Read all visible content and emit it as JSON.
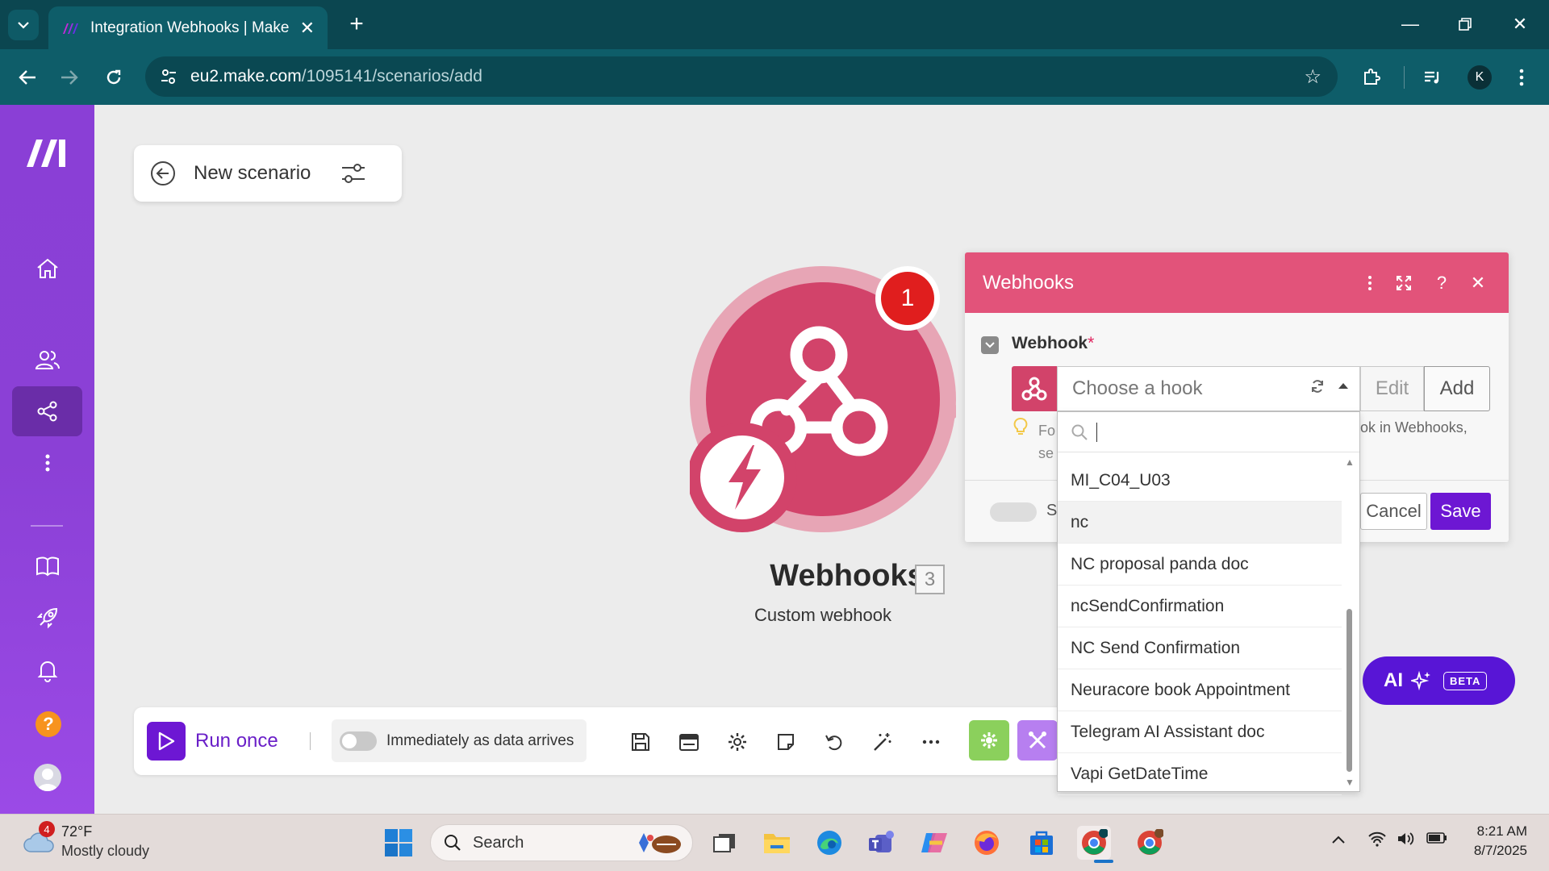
{
  "browser": {
    "tab_title": "Integration Webhooks | Make",
    "url_host": "eu2.make.com",
    "url_path": "/1095141/scenarios/add",
    "profile_initial": "K"
  },
  "scenario": {
    "title": "New scenario"
  },
  "module": {
    "title": "Webhooks",
    "id": "3",
    "subtitle": "Custom webhook",
    "badge_count": "1"
  },
  "controls": {
    "run_once": "Run once",
    "schedule_label": "Immediately as data arrives"
  },
  "ai_button": {
    "label": "AI",
    "badge": "BETA"
  },
  "panel": {
    "title": "Webhooks",
    "field_label": "Webhook",
    "required_mark": "*",
    "select_placeholder": "Choose a hook",
    "edit_label": "Edit",
    "add_label": "Add",
    "hint_left_1": "Fo",
    "hint_left_2": "se",
    "hint_right": "ok in Webhooks,",
    "advanced_label": "S",
    "cancel_label": "Cancel",
    "save_label": "Save"
  },
  "dropdown": {
    "items": [
      "MI_C04_U03",
      "nc",
      "NC proposal panda doc",
      "ncSendConfirmation",
      "NC Send Confirmation",
      "Neuracore book Appointment",
      "Telegram AI Assistant doc",
      "Vapi GetDateTime"
    ],
    "highlighted_index": 1
  },
  "taskbar": {
    "weather_badge": "4",
    "weather_temp": "72°F",
    "weather_desc": "Mostly cloudy",
    "search_label": "Search",
    "time": "8:21 AM",
    "date": "8/7/2025"
  },
  "colors": {
    "make_purple": "#6d17d3",
    "webhook_pink": "#e2537a",
    "sidebar_purple": "#8a3fd6"
  }
}
